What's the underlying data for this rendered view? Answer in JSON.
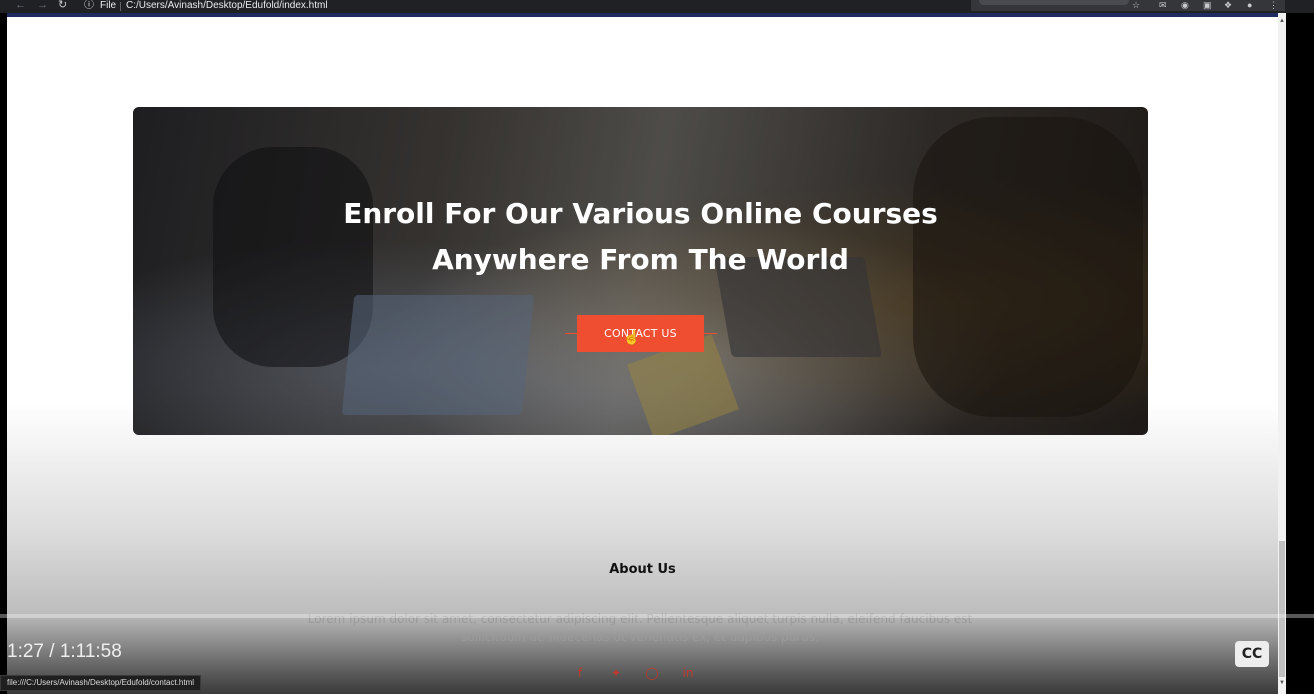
{
  "browser": {
    "file_label": "File",
    "url": "C:/Users/Avinash/Desktop/Edufold/index.html"
  },
  "hero": {
    "title_line1": "Enroll For Our Various Online Courses",
    "title_line2": "Anywhere From The World",
    "cta_label": "CONTACT US"
  },
  "about": {
    "title": "About Us",
    "text": "Lorem ipsum dolor sit amet, consectetur adipiscing elit. Pellentesque aliquet turpis nulla, eleifend faucibus est sollicitudin ut. Maecenas ut venenatis ex, et dapibus purus."
  },
  "social": {
    "items": [
      "facebook",
      "twitter",
      "instagram",
      "linkedin"
    ]
  },
  "video": {
    "time": "1:27 / 1:11:58",
    "cc_label": "CC"
  },
  "status_bar": {
    "url": "file:///C:/Users/Avinash/Desktop/Edufold/contact.html"
  },
  "colors": {
    "accent": "#f04e31",
    "browser_bar": "#202124"
  }
}
